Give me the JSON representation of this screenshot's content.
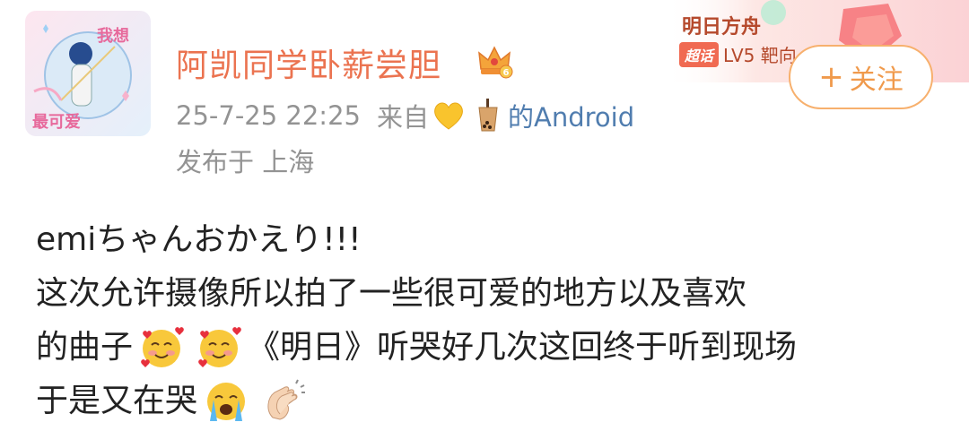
{
  "user": {
    "name": "阿凯同学卧薪尝胆",
    "avatar_stamp_top": "我想",
    "avatar_stamp_bottom": "最可爱",
    "vip_level": "6"
  },
  "meta": {
    "time": "25-7-25 22:25",
    "from_prefix": "来自",
    "source_suffix": "的Android",
    "location": "发布于 上海"
  },
  "chaohua": {
    "title": "明日方舟",
    "badge": "超话",
    "level": "LV5 靶向"
  },
  "follow": {
    "plus": "+",
    "label": "关注"
  },
  "post": {
    "line1": "emiちゃんおかえり!!!",
    "line2": "这次允许摄像所以拍了一些很可爱的地方以及喜欢",
    "line3_a": "的曲子",
    "line3_b": "《明日》听哭好几次这回终于听到现场",
    "line4": "于是又在哭"
  },
  "colors": {
    "username": "#eb7350",
    "meta_gray": "#939393",
    "source_blue": "#507daf",
    "follow_border": "#f7b06d",
    "follow_text": "#f09a4c"
  },
  "icons": {
    "crown": "vip-crown-icon",
    "heart": "yellow-heart-emoji",
    "tea": "bubble-tea-emoji",
    "love": "smiling-face-with-hearts-emoji",
    "cry": "loudly-crying-face-emoji",
    "clap": "clapping-hands-emoji"
  }
}
